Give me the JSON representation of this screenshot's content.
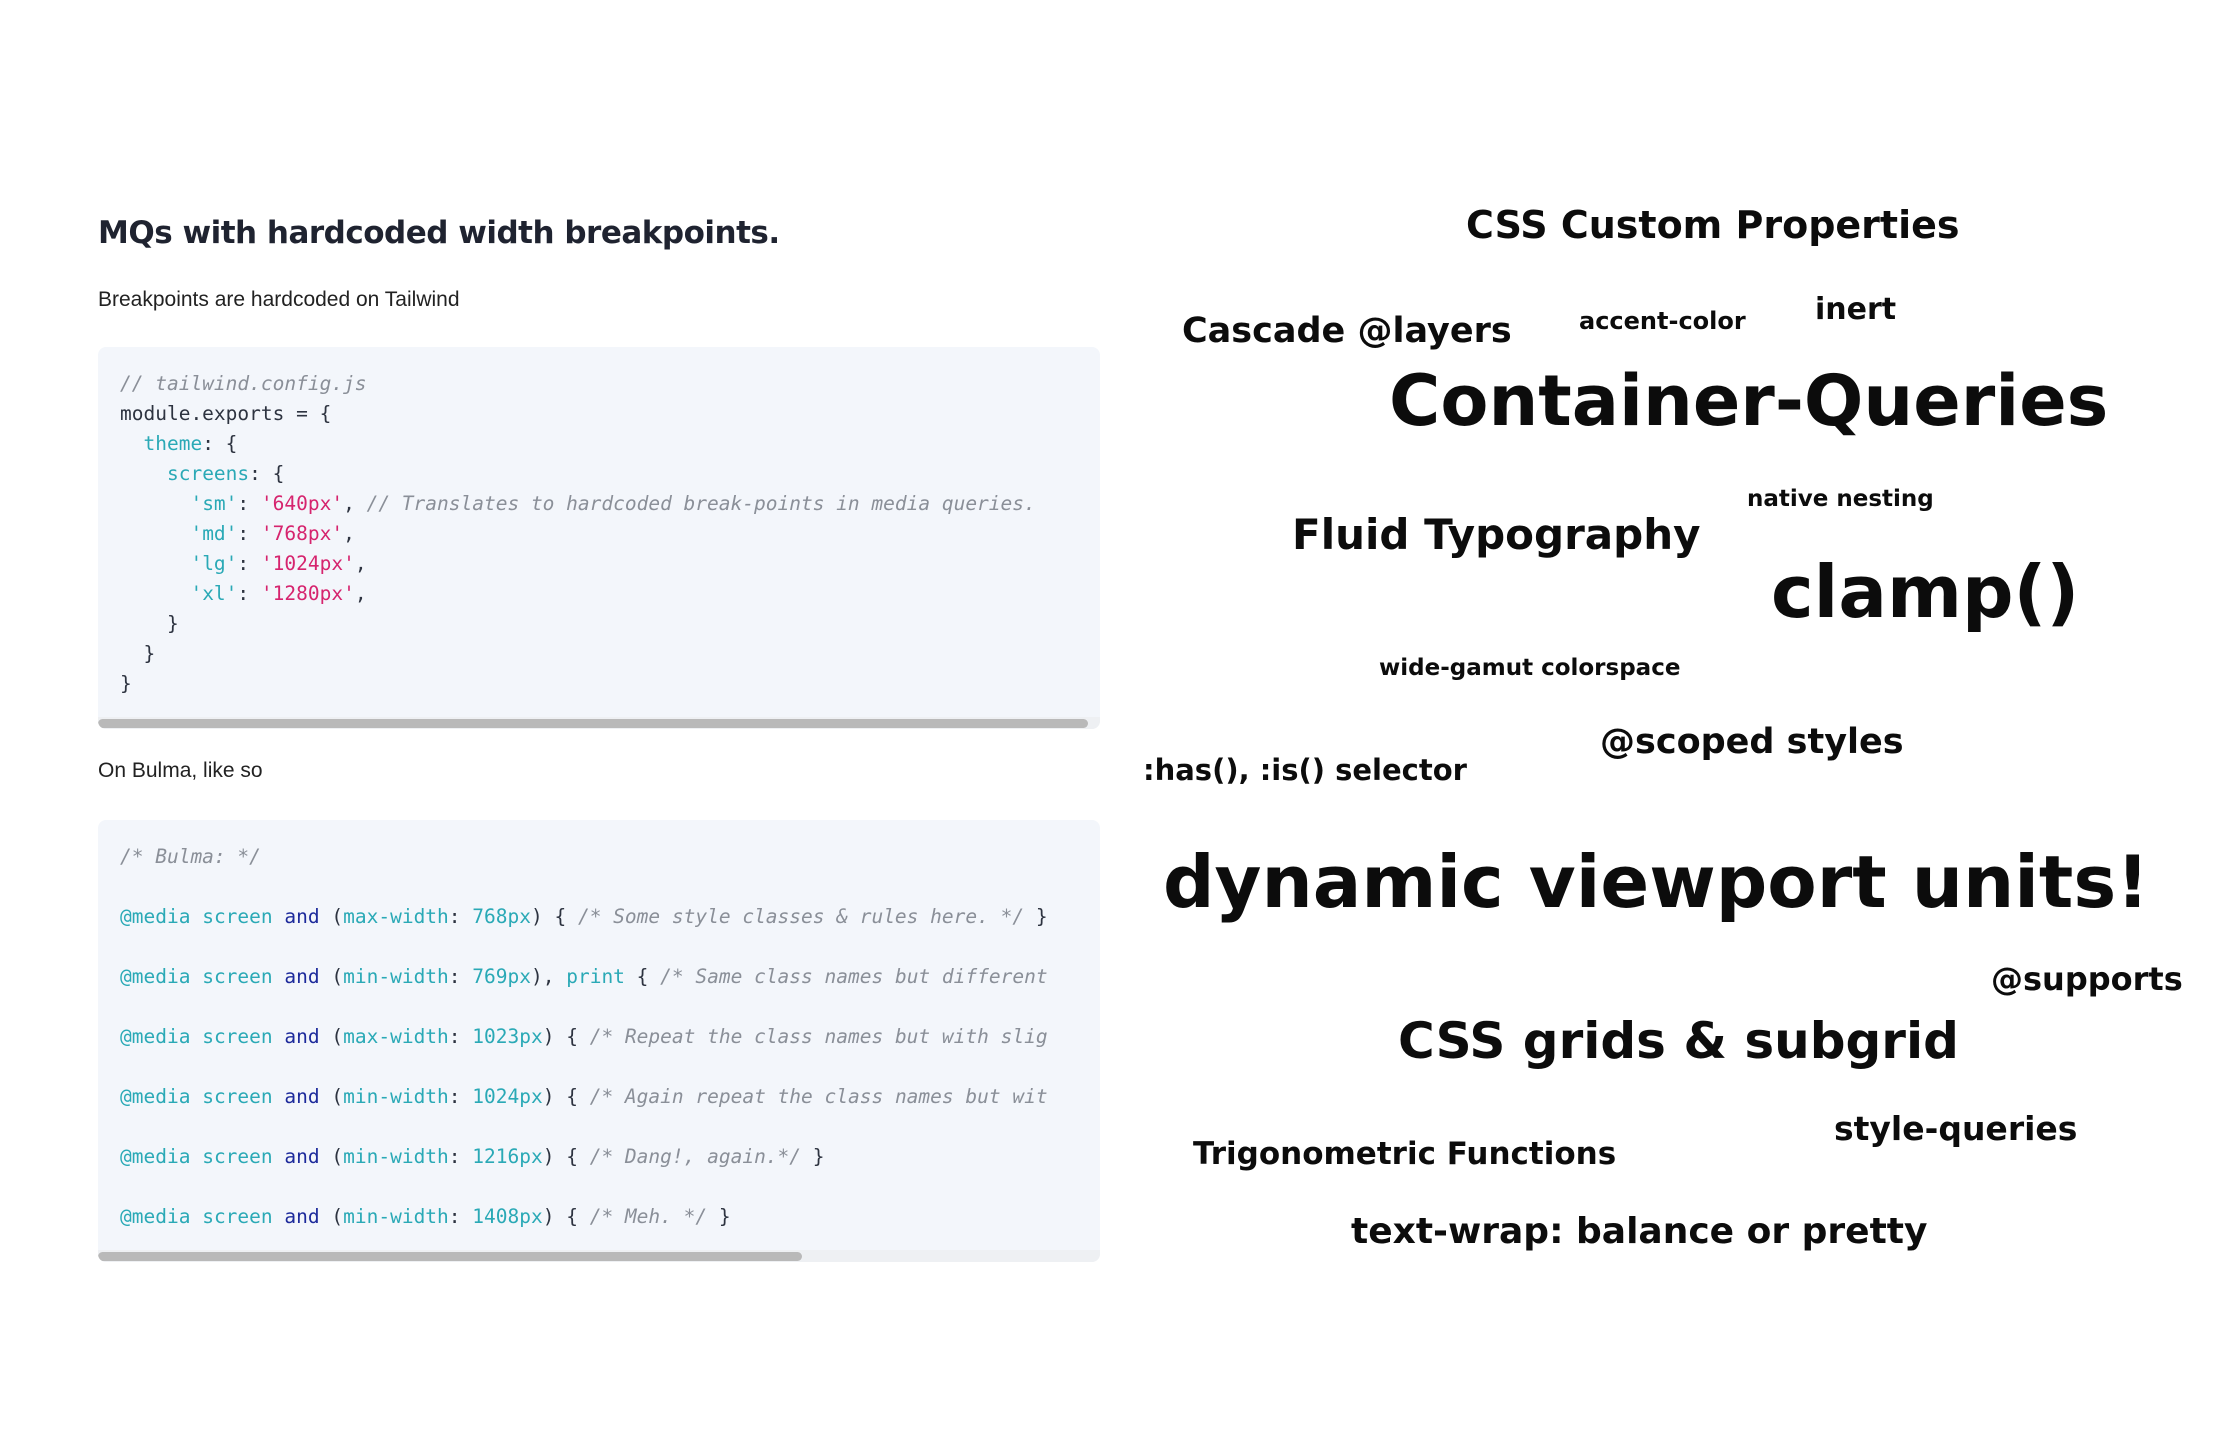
{
  "left_panel": {
    "heading": "MQs with hardcoded width breakpoints.",
    "para_tailwind": "Breakpoints are hardcoded on Tailwind",
    "para_bulma": "On Bulma, like so",
    "tailwind_code": [
      [
        [
          "cm",
          "// tailwind.config.js"
        ]
      ],
      [
        [
          "",
          "module.exports = {"
        ]
      ],
      [
        [
          "",
          "  "
        ],
        [
          "key",
          "theme"
        ],
        [
          "",
          ": {"
        ]
      ],
      [
        [
          "",
          "    "
        ],
        [
          "key",
          "screens"
        ],
        [
          "",
          ": {"
        ]
      ],
      [
        [
          "",
          "      "
        ],
        [
          "key",
          "'sm'"
        ],
        [
          "",
          ": "
        ],
        [
          "str",
          "'640px'"
        ],
        [
          "",
          ", "
        ],
        [
          "cm",
          "// Translates to hardcoded break-points in media queries."
        ]
      ],
      [
        [
          "",
          "      "
        ],
        [
          "key",
          "'md'"
        ],
        [
          "",
          ": "
        ],
        [
          "str",
          "'768px'"
        ],
        [
          "",
          ","
        ]
      ],
      [
        [
          "",
          "      "
        ],
        [
          "key",
          "'lg'"
        ],
        [
          "",
          ": "
        ],
        [
          "str",
          "'1024px'"
        ],
        [
          "",
          ","
        ]
      ],
      [
        [
          "",
          "      "
        ],
        [
          "key",
          "'xl'"
        ],
        [
          "",
          ": "
        ],
        [
          "str",
          "'1280px'"
        ],
        [
          "",
          ","
        ]
      ],
      [
        [
          "",
          "    }"
        ]
      ],
      [
        [
          "",
          "  }"
        ]
      ],
      [
        [
          "",
          "}"
        ]
      ]
    ],
    "bulma_code": [
      [
        [
          "cm",
          "/* Bulma: */"
        ]
      ],
      [
        [
          "at",
          "@media"
        ],
        [
          "",
          " "
        ],
        [
          "at",
          "screen"
        ],
        [
          "",
          " "
        ],
        [
          "kw",
          "and"
        ],
        [
          "",
          " ("
        ],
        [
          "prop",
          "max-width"
        ],
        [
          "",
          ": "
        ],
        [
          "num",
          "768px"
        ],
        [
          "",
          ") { "
        ],
        [
          "cm",
          "/* Some style classes & rules here. */"
        ],
        [
          "",
          " }"
        ]
      ],
      [
        [
          "at",
          "@media"
        ],
        [
          "",
          " "
        ],
        [
          "at",
          "screen"
        ],
        [
          "",
          " "
        ],
        [
          "kw",
          "and"
        ],
        [
          "",
          " ("
        ],
        [
          "prop",
          "min-width"
        ],
        [
          "",
          ": "
        ],
        [
          "num",
          "769px"
        ],
        [
          "",
          "), "
        ],
        [
          "at",
          "print"
        ],
        [
          "",
          " { "
        ],
        [
          "cm",
          "/* Same class names but different"
        ]
      ],
      [
        [
          "at",
          "@media"
        ],
        [
          "",
          " "
        ],
        [
          "at",
          "screen"
        ],
        [
          "",
          " "
        ],
        [
          "kw",
          "and"
        ],
        [
          "",
          " ("
        ],
        [
          "prop",
          "max-width"
        ],
        [
          "",
          ": "
        ],
        [
          "num",
          "1023px"
        ],
        [
          "",
          ") { "
        ],
        [
          "cm",
          "/* Repeat the class names but with slig"
        ]
      ],
      [
        [
          "at",
          "@media"
        ],
        [
          "",
          " "
        ],
        [
          "at",
          "screen"
        ],
        [
          "",
          " "
        ],
        [
          "kw",
          "and"
        ],
        [
          "",
          " ("
        ],
        [
          "prop",
          "min-width"
        ],
        [
          "",
          ": "
        ],
        [
          "num",
          "1024px"
        ],
        [
          "",
          ") { "
        ],
        [
          "cm",
          "/* Again repeat the class names but wit"
        ]
      ],
      [
        [
          "at",
          "@media"
        ],
        [
          "",
          " "
        ],
        [
          "at",
          "screen"
        ],
        [
          "",
          " "
        ],
        [
          "kw",
          "and"
        ],
        [
          "",
          " ("
        ],
        [
          "prop",
          "min-width"
        ],
        [
          "",
          ": "
        ],
        [
          "num",
          "1216px"
        ],
        [
          "",
          ") { "
        ],
        [
          "cm",
          "/* Dang!, again.*/"
        ],
        [
          "",
          " }"
        ]
      ],
      [
        [
          "at",
          "@media"
        ],
        [
          "",
          " "
        ],
        [
          "at",
          "screen"
        ],
        [
          "",
          " "
        ],
        [
          "kw",
          "and"
        ],
        [
          "",
          " ("
        ],
        [
          "prop",
          "min-width"
        ],
        [
          "",
          ": "
        ],
        [
          "num",
          "1408px"
        ],
        [
          "",
          ") { "
        ],
        [
          "cm",
          "/* Meh. */"
        ],
        [
          "",
          " }"
        ]
      ]
    ],
    "colors": {
      "comment": "#8a8f98",
      "key": "#2aa9b6",
      "string": "#d6246e",
      "keyword": "#1d2a9b",
      "code_bg": "#f3f6fb"
    }
  },
  "word_cloud": [
    {
      "text": "CSS Custom Properties"
    },
    {
      "text": "Cascade @layers"
    },
    {
      "text": "accent-color"
    },
    {
      "text": "inert"
    },
    {
      "text": "Container-Queries"
    },
    {
      "text": "native nesting"
    },
    {
      "text": "Fluid Typography"
    },
    {
      "text": "clamp()"
    },
    {
      "text": "wide-gamut colorspace"
    },
    {
      "text": "@scoped styles"
    },
    {
      "text": ":has(), :is() selector"
    },
    {
      "text": "dynamic viewport units!"
    },
    {
      "text": "@supports"
    },
    {
      "text": "CSS grids & subgrid"
    },
    {
      "text": "style-queries"
    },
    {
      "text": "Trigonometric Functions"
    },
    {
      "text": "text-wrap: balance or pretty"
    }
  ]
}
